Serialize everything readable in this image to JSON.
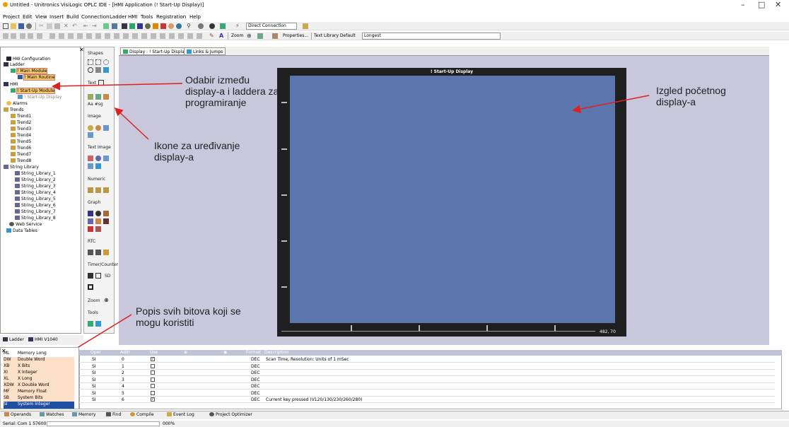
{
  "window": {
    "title": "Untitled - Unitronics VisiLogic OPLC IDE - [HMI Application (! Start-Up Display)]",
    "minimize": "–",
    "maximize": "□",
    "close": "✕"
  },
  "menu": [
    "Project",
    "Edit",
    "View",
    "Insert",
    "Build",
    "Connection",
    "Ladder",
    "HMI",
    "Tools",
    "Registration",
    "Help"
  ],
  "toolbar": {
    "connection_select": "Direct Connection",
    "zoom_label": "Zoom",
    "properties_label": "Properties...",
    "text_library_label": "Text Library Default",
    "text_library_select": "Longest"
  },
  "tree": {
    "items": [
      "HW Configuration",
      "Ladder",
      "! Main Module",
      "! Main Routine",
      "HMI",
      "! Start-Up Module",
      "! Start-Up Display",
      "Alarms",
      "Trends",
      "Trend1",
      "Trend2",
      "Trend3",
      "Trend4",
      "Trend5",
      "Trend6",
      "Trend7",
      "Trend8",
      "String Library",
      "String_Library_1",
      "String_Library_2",
      "String_Library_3",
      "String_Library_4",
      "String_Library_5",
      "String_Library_6",
      "String_Library_7",
      "String_Library_8",
      "Web Service",
      "Data Tables"
    ],
    "tabs": [
      "Ladder",
      "HMI V1040"
    ]
  },
  "shapes_panel": {
    "title": "Shapes",
    "sections": [
      "Text",
      "Image",
      "Text Image",
      "Numeric",
      "Graph",
      "RTC",
      "Timer/Counter",
      "Zoom",
      "Tools"
    ],
    "text_glyphs": "Aa #sg",
    "timer_glyph": "SD"
  },
  "doc_tabs": [
    "Display : ! Start-Up Display",
    "Links & Jumps"
  ],
  "display": {
    "title": "! Start-Up Display",
    "coords": "482, 70"
  },
  "annotations": {
    "display_vs_ladder": "Odabir između display-a i laddera za programiranje",
    "icons": "Ikone za uređivanje display-a",
    "preview": "Izgled početnog display-a",
    "bits": "Popis svih bitova koji se mogu koristiti"
  },
  "operands": [
    {
      "code": "ML",
      "name": "Memory Long"
    },
    {
      "code": "DW",
      "name": "Double Word"
    },
    {
      "code": "XB",
      "name": "X Bits"
    },
    {
      "code": "XI",
      "name": "X Integer"
    },
    {
      "code": "XL",
      "name": "X Long"
    },
    {
      "code": "XDW",
      "name": "X Double Word"
    },
    {
      "code": "MF",
      "name": "Memory Float"
    },
    {
      "code": "SB",
      "name": "System Bits"
    },
    {
      "code": "SI",
      "name": "System Integer"
    }
  ],
  "grid": {
    "headers": [
      "Oper",
      "Addr",
      "Use",
      "Format",
      "Description"
    ],
    "rows": [
      {
        "op": "SI",
        "addr": "0",
        "use": true,
        "fmt": "DEC",
        "desc": "Scan Time, Resolution: Units of 1 mSec"
      },
      {
        "op": "SI",
        "addr": "1",
        "use": false,
        "fmt": "DEC",
        "desc": ""
      },
      {
        "op": "SI",
        "addr": "2",
        "use": false,
        "fmt": "DEC",
        "desc": ""
      },
      {
        "op": "SI",
        "addr": "3",
        "use": false,
        "fmt": "DEC",
        "desc": ""
      },
      {
        "op": "SI",
        "addr": "4",
        "use": false,
        "fmt": "DEC",
        "desc": ""
      },
      {
        "op": "SI",
        "addr": "5",
        "use": false,
        "fmt": "DEC",
        "desc": ""
      },
      {
        "op": "SI",
        "addr": "6",
        "use": true,
        "fmt": "DEC",
        "desc": "Current key pressed  (V120/130/230/260/280)"
      }
    ]
  },
  "bottom_tabs": [
    "Operands",
    "Watches",
    "Memory",
    "Find",
    "Compile",
    "Event Log",
    "Project Optimizer"
  ],
  "status": {
    "port": "Serial: Com 1 57600",
    "percent": "000%"
  },
  "colors": {
    "canvas": "#5b76ad",
    "design_bg": "#c8c7dc",
    "arrow": "#e02020"
  }
}
